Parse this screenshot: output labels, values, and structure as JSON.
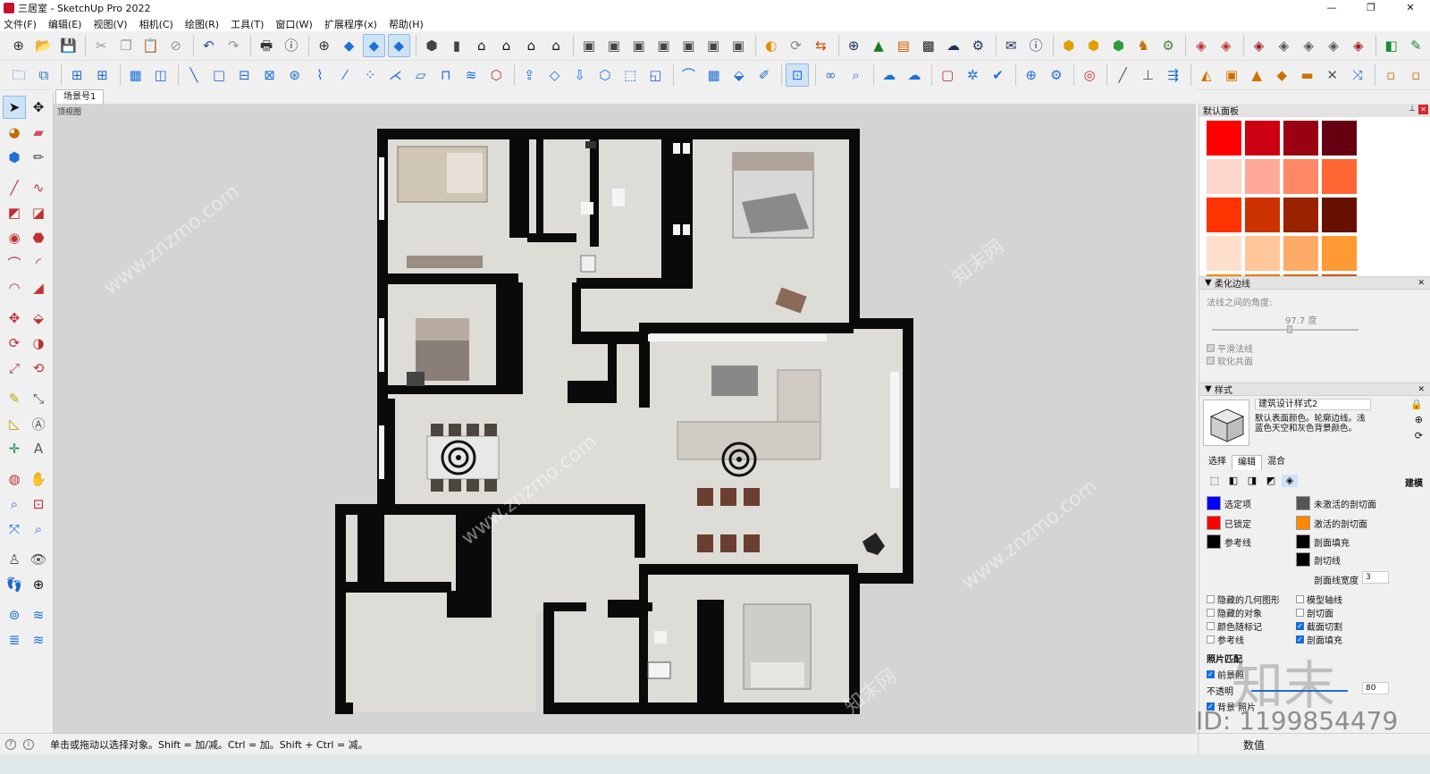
{
  "window": {
    "title": "三居室 - SketchUp Pro 2022",
    "controls": {
      "minimize": "—",
      "maximize": "❐",
      "close": "✕"
    }
  },
  "menu": [
    "文件(F)",
    "编辑(E)",
    "视图(V)",
    "相机(C)",
    "绘图(R)",
    "工具(T)",
    "窗口(W)",
    "扩展程序(x)",
    "帮助(H)"
  ],
  "scene": {
    "tab_label": "场景号1",
    "view_label": "顶视图"
  },
  "default_tray": {
    "title": "默认面板",
    "swatches": [
      "#ff0000",
      "#cc0011",
      "#990011",
      "#660011",
      "#ffd6cc",
      "#ffaa99",
      "#ff8866",
      "#ff6633",
      "#ff3300",
      "#cc3300",
      "#992200",
      "#661100",
      "#ffe0cc",
      "#ffc699",
      "#ffaa66",
      "#ff9933",
      "#ff8800",
      "#ee7700",
      "#dd6600",
      "#cc5500"
    ]
  },
  "soften_edges": {
    "title": "柔化边线",
    "angle_label": "法线之间的角度:",
    "angle_value": "97.7 度",
    "smooth_normals": "平滑法线",
    "soften_coplanar": "软化共面"
  },
  "styles": {
    "title": "样式",
    "name": "建筑设计样式2",
    "description": "默认表面颜色。轮廓边线。浅蓝色天空和灰色背景颜色。",
    "tabs": [
      "选择",
      "编辑",
      "混合"
    ],
    "active_tab": "编辑",
    "mode_label": "建模",
    "colors": [
      {
        "label": "选定项",
        "color": "#0000ff"
      },
      {
        "label": "已锁定",
        "color": "#ff0000"
      },
      {
        "label": "参考线",
        "color": "#000000"
      },
      {
        "label": "未激活的剖切面",
        "color": "#555555"
      },
      {
        "label": "激活的剖切面",
        "color": "#ff8800"
      },
      {
        "label": "剖面填充",
        "color": "#000000"
      },
      {
        "label": "剖切线",
        "color": "#000000"
      }
    ],
    "section_width_label": "剖面线宽度",
    "section_width_value": "3",
    "checkboxes_left": [
      {
        "label": "隐藏的几何图形",
        "checked": false
      },
      {
        "label": "隐藏的对象",
        "checked": false
      },
      {
        "label": "颜色随标记",
        "checked": false
      },
      {
        "label": "参考线",
        "checked": false
      }
    ],
    "checkboxes_right": [
      {
        "label": "模型轴线",
        "checked": false
      },
      {
        "label": "剖切面",
        "checked": false
      },
      {
        "label": "截面切割",
        "checked": true
      },
      {
        "label": "剖面填充",
        "checked": true
      }
    ],
    "photo_match_label": "照片匹配",
    "foreground_label": "前景照",
    "opacity_label": "不透明",
    "opacity_value": "80",
    "background_label": "背景 照片"
  },
  "statusbar": {
    "message": "单击或拖动以选择对象。Shift = 加/减。Ctrl = 加。Shift + Ctrl = 减。",
    "measurement_label": "数值"
  },
  "watermarks": {
    "site": "www.znzmo.com",
    "brand": "知末网",
    "logo_text": "知末",
    "image_id": "ID: 1199854479"
  },
  "accent_colors": {
    "active_button": "#cfe3f7",
    "checkbox_on": "#1a6ed8",
    "tray_close": "#d8262e"
  }
}
